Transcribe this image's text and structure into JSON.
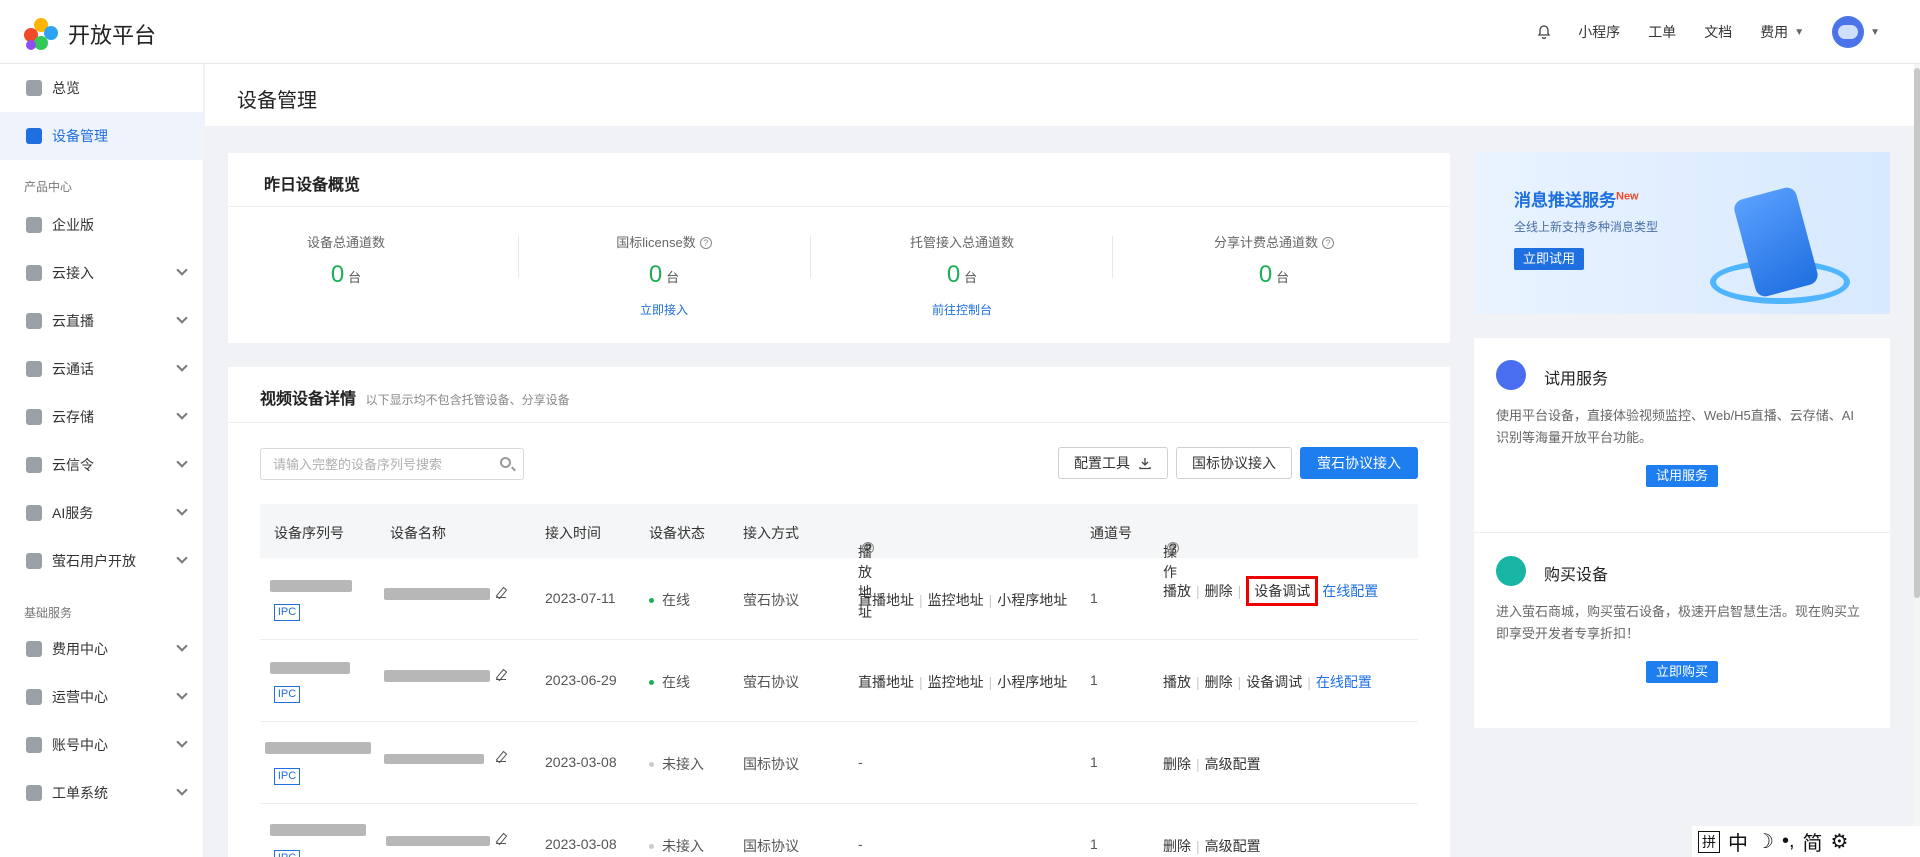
{
  "header": {
    "logo_text": "开放平台",
    "nav": [
      {
        "label": "小程序"
      },
      {
        "label": "工单"
      },
      {
        "label": "文档"
      },
      {
        "label": "费用"
      }
    ]
  },
  "sidebar": {
    "top_items": [
      {
        "label": "总览"
      },
      {
        "label": "设备管理",
        "active": true
      }
    ],
    "group1_label": "产品中心",
    "group1_items": [
      {
        "label": "企业版"
      },
      {
        "label": "云接入"
      },
      {
        "label": "云直播"
      },
      {
        "label": "云通话"
      },
      {
        "label": "云存储"
      },
      {
        "label": "云信令"
      },
      {
        "label": "AI服务"
      },
      {
        "label": "萤石用户开放"
      }
    ],
    "group2_label": "基础服务",
    "group2_items": [
      {
        "label": "费用中心"
      },
      {
        "label": "运营中心"
      },
      {
        "label": "账号中心"
      },
      {
        "label": "工单系统"
      }
    ]
  },
  "page": {
    "title": "设备管理"
  },
  "overview": {
    "title": "昨日设备概览",
    "stats": [
      {
        "label": "设备总通道数",
        "value": "0",
        "unit": "台",
        "link": ""
      },
      {
        "label": "国标license数",
        "value": "0",
        "unit": "台",
        "link": "立即接入"
      },
      {
        "label": "托管接入总通道数",
        "value": "0",
        "unit": "台",
        "link": "前往控制台"
      },
      {
        "label": "分享计费总通道数",
        "value": "0",
        "unit": "台",
        "link": ""
      }
    ]
  },
  "devices": {
    "title": "视频设备详情",
    "subtitle": "以下显示均不包含托管设备、分享设备",
    "search_placeholder": "请输入完整的设备序列号搜索",
    "buttons": {
      "config_tool": "配置工具",
      "gb_access": "国标协议接入",
      "ys_access": "萤石协议接入"
    },
    "columns": {
      "serial": "设备序列号",
      "name": "设备名称",
      "time": "接入时间",
      "status": "设备状态",
      "method": "接入方式",
      "play": "播放地址",
      "channel": "通道号",
      "ops": "操作"
    },
    "tag": "IPC",
    "rows": [
      {
        "time": "2023-07-11",
        "status": "在线",
        "method": "萤石协议",
        "play": [
          "直播地址",
          "监控地址",
          "小程序地址"
        ],
        "channel": "1",
        "ops": [
          "播放",
          "删除",
          "设备调试",
          "在线配置"
        ]
      },
      {
        "time": "2023-06-29",
        "status": "在线",
        "method": "萤石协议",
        "play": [
          "直播地址",
          "监控地址",
          "小程序地址"
        ],
        "channel": "1",
        "ops": [
          "播放",
          "删除",
          "设备调试",
          "在线配置"
        ]
      },
      {
        "time": "2023-03-08",
        "status": "未接入",
        "method": "国标协议",
        "play_dash": "-",
        "channel": "1",
        "ops": [
          "删除",
          "高级配置"
        ]
      },
      {
        "time": "2023-03-08",
        "status": "未接入",
        "method": "国标协议",
        "play_dash": "-",
        "channel": "1",
        "ops": [
          "删除",
          "高级配置"
        ]
      }
    ]
  },
  "banner": {
    "title": "消息推送服务",
    "badge": "New",
    "subtitle": "全线上新支持多种消息类型",
    "button": "立即试用"
  },
  "trial": {
    "title": "试用服务",
    "desc": "使用平台设备，直接体验视频监控、Web/H5直播、云存储、AI识别等海量开放平台功能。",
    "button": "试用服务"
  },
  "buy": {
    "title": "购买设备",
    "desc": "进入萤石商城，购买萤石设备，极速开启智慧生活。现在购买立即享受开发者专享折扣！",
    "button": "立即购买"
  },
  "ime": {
    "glyphs": [
      "拼",
      "中",
      "简"
    ]
  },
  "colors": {
    "primary": "#1e7ef0",
    "online": "#1cae54",
    "highlight": "#e00000"
  }
}
